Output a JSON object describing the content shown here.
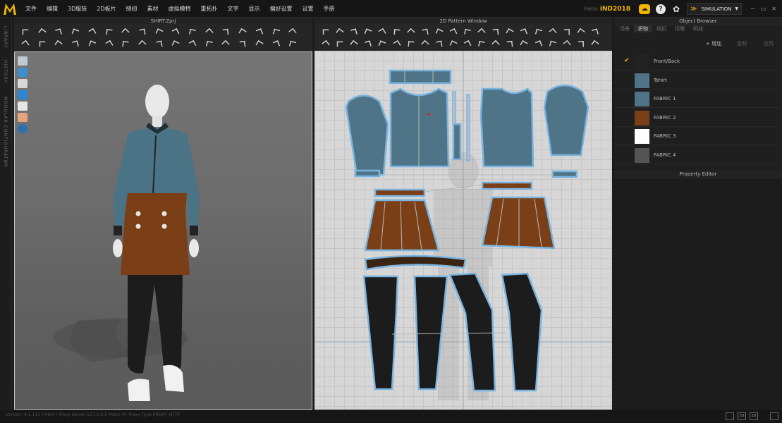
{
  "menu": [
    "文件",
    "编辑",
    "3D服装",
    "2D板片",
    "缝纫",
    "素材",
    "虚拟模特",
    "重拓扑",
    "文字",
    "显示",
    "偏好设置",
    "设置",
    "手册"
  ],
  "user": {
    "hello": "Hello",
    "name": "iND2018"
  },
  "simulation": {
    "label": "SIMULATION"
  },
  "window_controls": [
    "−",
    "▭",
    "✕"
  ],
  "side_tabs": [
    "LIBRARY",
    "HISTORY",
    "MODULAR CONFIGURATOR"
  ],
  "panels": {
    "view3d_title": "SHIRT.Zprj",
    "pattern_title": "2D Pattern Window",
    "object_browser_title": "Object Browser",
    "property_editor_title": "Property Editor"
  },
  "object_browser": {
    "tabs": [
      "场景",
      "织物",
      "纽扣",
      "扣眼",
      "明线"
    ],
    "active_tab": "织物",
    "actions": {
      "add": "+ 增加",
      "copy": "复制",
      "apply": "应用"
    },
    "fabrics": [
      {
        "name": "Front/Back",
        "color": "#222222",
        "checked": true
      },
      {
        "name": "Tshirt",
        "color": "#4f7487",
        "checked": false
      },
      {
        "name": "FABRIC 1",
        "color": "#4f7487",
        "checked": false
      },
      {
        "name": "FABRIC 2",
        "color": "#7a3f17",
        "checked": false
      },
      {
        "name": "FABRIC 3",
        "color": "#ffffff",
        "checked": false
      },
      {
        "name": "FABRIC 4",
        "color": "#555555",
        "checked": false
      }
    ]
  },
  "status": "Version: 4.1.111 (r4697)   Proxy Server:127.0.0.1   Public IP:   Proxy Type:PROXY_HTTP",
  "view_buttons": [
    "",
    "3D",
    "2D",
    ""
  ],
  "colors": {
    "accent": "#f0b400",
    "teal_fabric": "#4f7487",
    "brown_fabric": "#7a3f17",
    "black_fabric": "#1c1c1c",
    "outline": "#79b4e0"
  }
}
